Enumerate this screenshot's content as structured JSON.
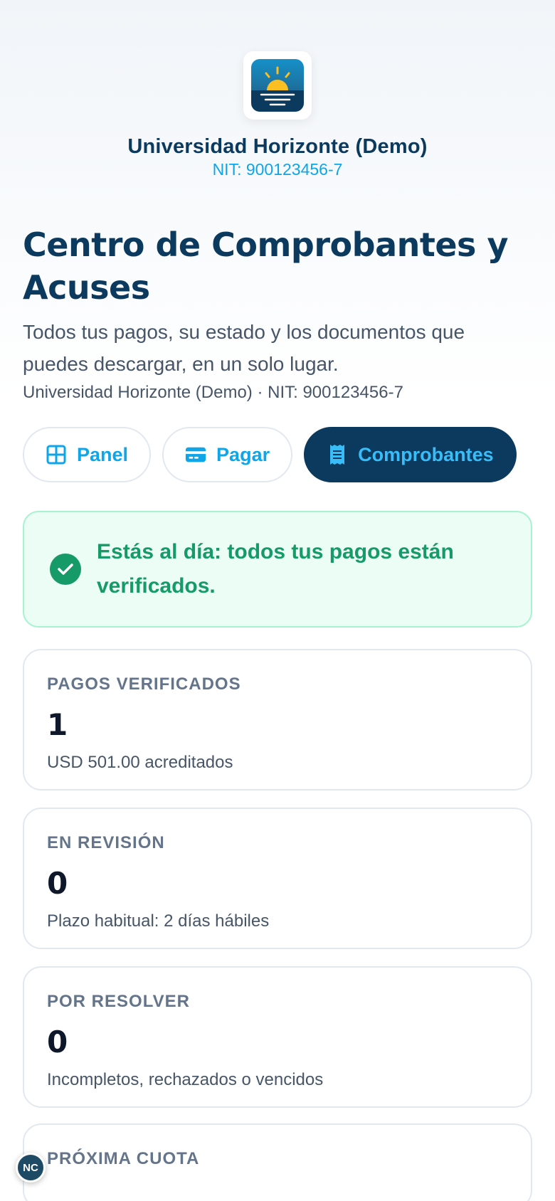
{
  "header": {
    "org_name": "Universidad Horizonte (Demo)",
    "nit": "NIT: 900123456-7",
    "logo_icon": "sunrise-logo-icon"
  },
  "intro": {
    "title": "Centro de Comprobantes y Acuses",
    "subtitle": "Todos tus pagos, su estado y los documentos que puedes descargar, en un solo lugar.",
    "org_line": "Universidad Horizonte (Demo) · NIT: 900123456-7"
  },
  "tabs": [
    {
      "label": "Panel",
      "icon": "grid-icon",
      "active": false
    },
    {
      "label": "Pagar",
      "icon": "credit-card-icon",
      "active": false
    },
    {
      "label": "Comprobantes",
      "icon": "receipt-icon",
      "active": true
    }
  ],
  "alert": {
    "icon": "check-circle-icon",
    "message": "Estás al día: todos tus pagos están verificados."
  },
  "stats": [
    {
      "label": "PAGOS VERIFICADOS",
      "value": "1",
      "note": "USD 501.00 acreditados"
    },
    {
      "label": "EN REVISIÓN",
      "value": "0",
      "note": "Plazo habitual: 2 días hábiles"
    },
    {
      "label": "POR RESOLVER",
      "value": "0",
      "note": "Incompletos, rechazados o vencidos"
    },
    {
      "label": "PRÓXIMA CUOTA"
    }
  ],
  "fab": {
    "initials": "NC"
  },
  "colors": {
    "brand_navy": "#0b3a5e",
    "accent_sky": "#0ea5e9",
    "success_green": "#169a67",
    "success_bg": "#ecfdf5"
  }
}
